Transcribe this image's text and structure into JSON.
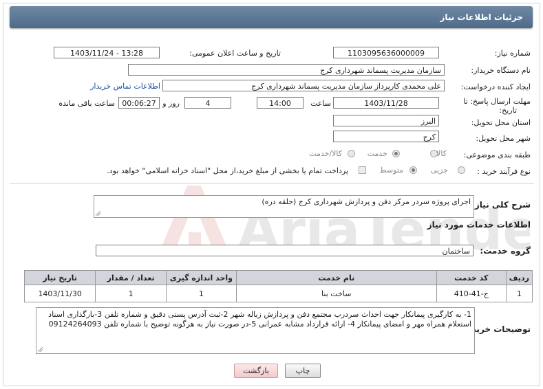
{
  "header": {
    "title": "جزئیات اطلاعات نیاز"
  },
  "form": {
    "need_number_label": "شماره نیاز:",
    "need_number": "1103095636000009",
    "announce_label": "تاریخ و ساعت اعلان عمومی:",
    "announce_value": "1403/11/24 - 13:28",
    "buyer_label": "نام دستگاه خریدار:",
    "buyer_value": "سازمان مدیریت پسماند شهرداری کرج",
    "creator_label": "ایجاد کننده درخواست:",
    "creator_value": "علی محمدی کارپرداز سازمان مدیریت پسماند شهرداری کرج",
    "contact_link": "اطلاعات تماس خریدار",
    "deadline_label_1": "مهلت ارسال پاسخ: تا",
    "deadline_label_2": "تاریخ:",
    "deadline_date": "1403/11/28",
    "time_label": "ساعت",
    "deadline_time": "14:00",
    "days_value": "4",
    "days_label": "روز و",
    "remaining_value": "00:06:27",
    "remaining_label": "ساعت باقی مانده",
    "province_label": "استان محل تحویل:",
    "province_value": "البرز",
    "city_label": "شهر محل تحویل:",
    "city_value": "کرج",
    "category_label": "طبقه بندی موضوعی:",
    "category_options": [
      "کالا",
      "خدمت",
      "کالا/خدمت"
    ],
    "category_selected": "خدمت",
    "purchase_label": "نوع فرآیند خرید :",
    "purchase_options": [
      "جزیی",
      "متوسط"
    ],
    "purchase_selected": "متوسط",
    "payment_note": "پرداخت تمام یا بخشی از مبلغ خرید،از محل \"اسناد خزانه اسلامی\" خواهد بود."
  },
  "description": {
    "label": "شرح کلی نیاز:",
    "value": "اجرای پروژه سردر مرکز دفن و پردازش شهرداری کرج (حلقه دره)"
  },
  "services": {
    "section_title": "اطلاعات خدمات مورد نیاز",
    "group_label": "گروه خدمت:",
    "group_value": "ساختمان",
    "columns": [
      "ردیف",
      "کد خدمت",
      "نام خدمت",
      "واحد اندازه گیری",
      "تعداد / مقدار",
      "تاریخ نیاز"
    ],
    "rows": [
      {
        "row": "1",
        "code": "ج-41-410",
        "name": "ساخت بنا",
        "unit": "1",
        "qty": "1",
        "date": "1403/11/30"
      }
    ]
  },
  "buyer_notes": {
    "label": "توضیحات خریدار:",
    "value": "1- به کارگیری پیمانکار جهت احداث سردرب مجتمع دفن و پردازش زباله شهر 2-ثبت آدرس پستی دقیق و شماره تلفن 3-بارگذاری اسناد استعلام همراه مهر و امضای پیمانکار 4- ارائه قرارداد مشابه عمرانی 5-در صورت نیاز به هرگونه توضیح با شماره تلفن 09124264093"
  },
  "buttons": {
    "print": "چاپ",
    "back": "بازگشت"
  },
  "watermark": {
    "text": "AriaTender.neT"
  },
  "colors": {
    "header": "#56718f",
    "link": "#1f4fa8",
    "table_header": "#d2d6dc"
  }
}
